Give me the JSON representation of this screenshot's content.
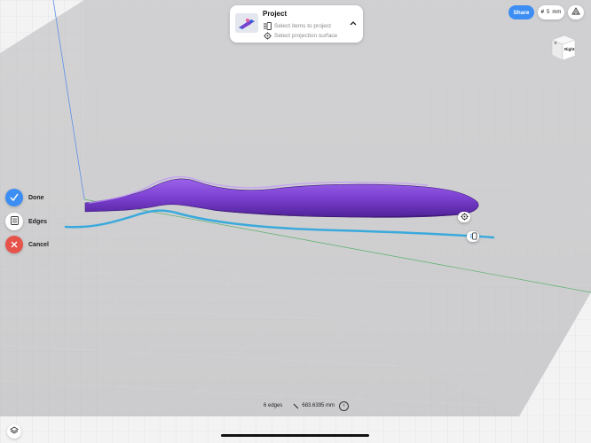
{
  "project_panel": {
    "title": "Project",
    "select_items": "Select items to project",
    "select_surface": "Select projection surface"
  },
  "toolbar": {
    "share_label": "Share",
    "grid_value": "5",
    "grid_unit": "mm"
  },
  "view_cube": {
    "face_label": "Right"
  },
  "side_actions": {
    "done_label": "Done",
    "edges_label": "Edges",
    "cancel_label": "Cancel"
  },
  "status": {
    "selection": "6 edges",
    "length": "683.6395 mm"
  },
  "colors": {
    "accent": "#3d8ef3",
    "cancel": "#e5534b",
    "body": "#7b3fd0",
    "projected_curve": "#3aa9dc"
  },
  "icons": [
    "project-icon",
    "select-items-icon",
    "crosshair-icon",
    "chevron-up-icon",
    "snap-icon",
    "checkmark-icon",
    "edges-icon",
    "close-icon",
    "layers-icon",
    "measure-icon",
    "unit-cycle-icon"
  ]
}
